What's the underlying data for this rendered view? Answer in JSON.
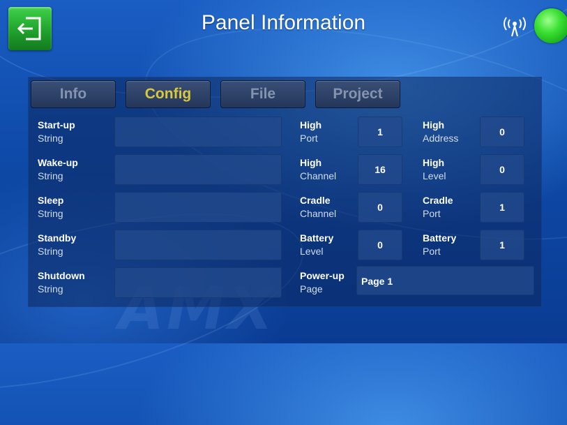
{
  "header": {
    "title": "Panel Information"
  },
  "tabs": [
    {
      "label": "Info",
      "active": false
    },
    {
      "label": "Config",
      "active": true
    },
    {
      "label": "File",
      "active": false
    },
    {
      "label": "Project",
      "active": false
    }
  ],
  "strings": [
    {
      "name": "Start-up",
      "type": "String",
      "value": ""
    },
    {
      "name": "Wake-up",
      "type": "String",
      "value": ""
    },
    {
      "name": "Sleep",
      "type": "String",
      "value": ""
    },
    {
      "name": "Standby",
      "type": "String",
      "value": ""
    },
    {
      "name": "Shutdown",
      "type": "String",
      "value": ""
    }
  ],
  "params_left": [
    {
      "l1": "High",
      "l2": "Port",
      "value": "1"
    },
    {
      "l1": "High",
      "l2": "Channel",
      "value": "16"
    },
    {
      "l1": "Cradle",
      "l2": "Channel",
      "value": "0"
    },
    {
      "l1": "Battery",
      "l2": "Level",
      "value": "0"
    }
  ],
  "params_right": [
    {
      "l1": "High",
      "l2": "Address",
      "value": "0"
    },
    {
      "l1": "High",
      "l2": "Level",
      "value": "0"
    },
    {
      "l1": "Cradle",
      "l2": "Port",
      "value": "1"
    },
    {
      "l1": "Battery",
      "l2": "Port",
      "value": "1"
    }
  ],
  "powerup": {
    "l1": "Power-up",
    "l2": "Page",
    "value": "Page 1"
  },
  "watermark": "AMX",
  "status": {
    "connected": true,
    "color": "#2fd12a"
  },
  "colors": {
    "accent_tab": "#d9c83a",
    "exit_button": "#22a32e"
  },
  "icons": {
    "exit": "exit-icon",
    "signal": "wireless-signal-icon"
  }
}
